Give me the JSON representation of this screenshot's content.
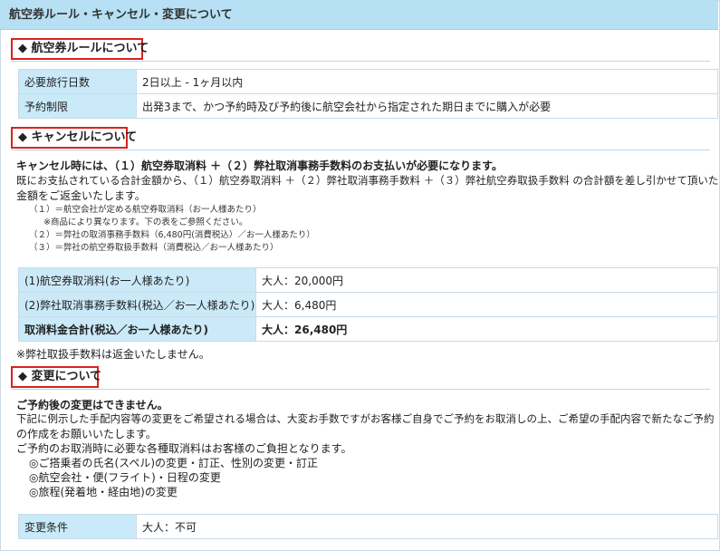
{
  "header": {
    "title": "航空券ルール・キャンセル・変更について"
  },
  "sections": {
    "rules": {
      "title": "航空券ルールについて"
    },
    "cancel": {
      "title": "キャンセルについて"
    },
    "change": {
      "title": "変更について"
    }
  },
  "rules_table": [
    {
      "label": "必要旅行日数",
      "value": "2日以上 - 1ヶ月以内"
    },
    {
      "label": "予約制限",
      "value": "出発3まで、かつ予約時及び予約後に航空会社から指定された期日までに購入が必要"
    }
  ],
  "cancel": {
    "lead": "キャンセル時には、（１）航空券取消料 ＋（２）弊社取消事務手数料のお支払いが必要になります。",
    "body_line1": "既にお支払されている合計金額から、（１）航空券取消料 ＋（２）弊社取消事務手数料 ＋（３）弊社航空券取扱手数料 の合計額を差し引かせて頂いた",
    "body_line2": "金額をご返金いたします。",
    "notes": [
      "（１）＝航空会社が定める航空券取消料（お一人様あたり）",
      "※商品により異なります。下の表をご参照ください。",
      "（２）＝弊社の取消事務手数料（6,480円(消費税込）／お一人様あたり）",
      "（３）＝弊社の航空券取扱手数料（消費税込／お一人様あたり）"
    ],
    "fees": [
      {
        "label": "(1)航空券取消料(お一人様あたり)",
        "value": "大人：20,000円"
      },
      {
        "label": "(2)弊社取消事務手数料(税込／お一人様あたり)",
        "value": "大人：6,480円"
      },
      {
        "label": "取消料金合計(税込／お一人様あたり)",
        "value": "大人：26,480円"
      }
    ],
    "footnote": "※弊社取扱手数料は返金いたしません。"
  },
  "change": {
    "lead": "ご予約後の変更はできません。",
    "body_line1": "下記に例示した手配内容等の変更をご希望される場合は、大変お手数ですがお客様ご自身でご予約をお取消しの上、ご希望の手配内容で新たなご予約",
    "body_line2": "の作成をお願いいたします。",
    "body_line3": "ご予約のお取消時に必要な各種取消料はお客様のご負担となります。",
    "items": [
      "◎ご搭乗者の氏名(スペル)の変更・訂正、性別の変更・訂正",
      "◎航空会社・便(フライト)・日程の変更",
      "◎旅程(発着地・経由地)の変更"
    ],
    "table": [
      {
        "label": "変更条件",
        "value": "大人：不可"
      }
    ]
  },
  "icons": {
    "section_marker": "black-diamond-icon"
  }
}
